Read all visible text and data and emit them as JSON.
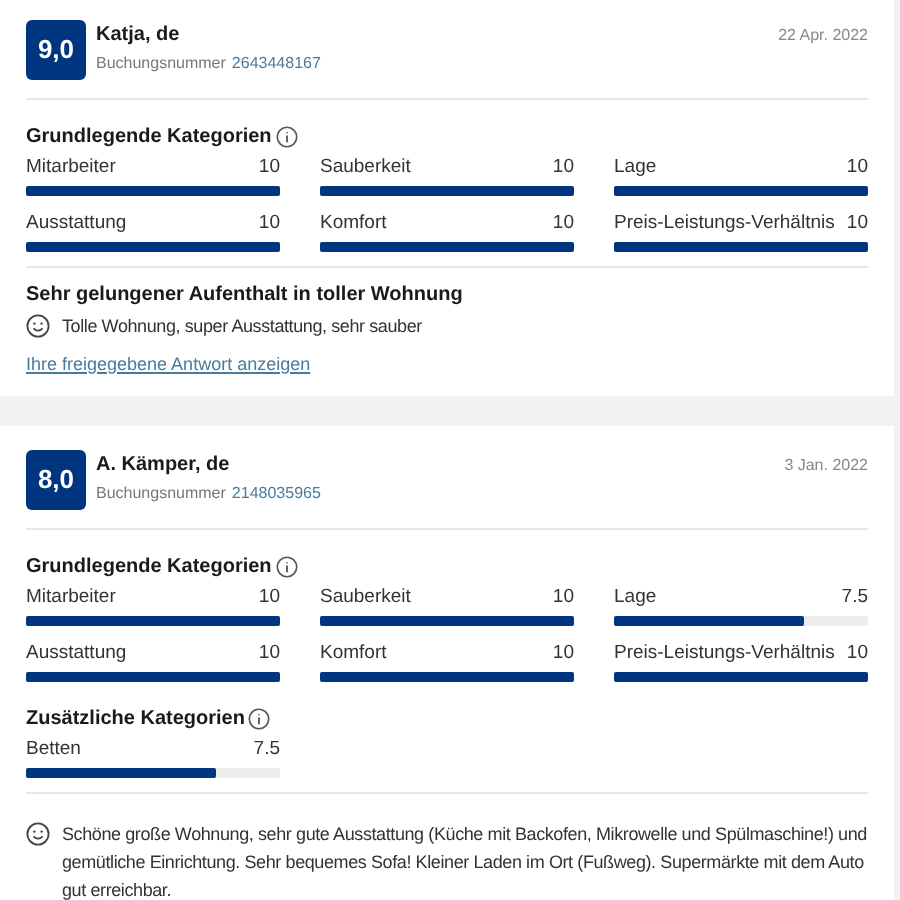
{
  "reviews": [
    {
      "score": "9,0",
      "name": "Katja, de",
      "booking_label": "Buchungsnummer",
      "booking_number": "2643448167",
      "date": "22 Apr. 2022",
      "sections": [
        {
          "title": "Grundlegende Kategorien",
          "categories": [
            {
              "label": "Mitarbeiter",
              "value": "10",
              "level": 1
            },
            {
              "label": "Sauberkeit",
              "value": "10",
              "level": 1
            },
            {
              "label": "Lage",
              "value": "10",
              "level": 1
            },
            {
              "label": "Ausstattung",
              "value": "10",
              "level": 1
            },
            {
              "label": "Komfort",
              "value": "10",
              "level": 1
            },
            {
              "label": "Preis-Leistungs-Verhältnis",
              "value": "10",
              "level": 1
            }
          ]
        }
      ],
      "headline": "Sehr gelungener Aufenthalt in toller Wohnung",
      "comment": "Tolle Wohnung, super Ausstattung, sehr sauber",
      "link": "Ihre freigegebene Antwort anzeigen"
    },
    {
      "score": "8,0",
      "name": "A. Kämper, de",
      "booking_label": "Buchungsnummer",
      "booking_number": "2148035965",
      "date": "3 Jan. 2022",
      "sections": [
        {
          "title": "Grundlegende Kategorien",
          "categories": [
            {
              "label": "Mitarbeiter",
              "value": "10",
              "level": 1
            },
            {
              "label": "Sauberkeit",
              "value": "10",
              "level": 1
            },
            {
              "label": "Lage",
              "value": "7.5",
              "level": 0.75
            },
            {
              "label": "Ausstattung",
              "value": "10",
              "level": 1
            },
            {
              "label": "Komfort",
              "value": "10",
              "level": 1
            },
            {
              "label": "Preis-Leistungs-Verhältnis",
              "value": "10",
              "level": 1
            }
          ]
        },
        {
          "title": "Zusätzliche Kategorien",
          "categories": [
            {
              "label": "Betten",
              "value": "7.5",
              "level": 0.75
            }
          ]
        }
      ],
      "comment": "Schöne große Wohnung, sehr gute Ausstattung (Küche mit Backofen, Mikrowelle und Spülmaschine!) und gemütliche Einrichtung. Sehr bequemes Sofa! Kleiner Laden im Ort (Fußweg). Supermärkte mit dem Auto gut erreichbar."
    }
  ]
}
